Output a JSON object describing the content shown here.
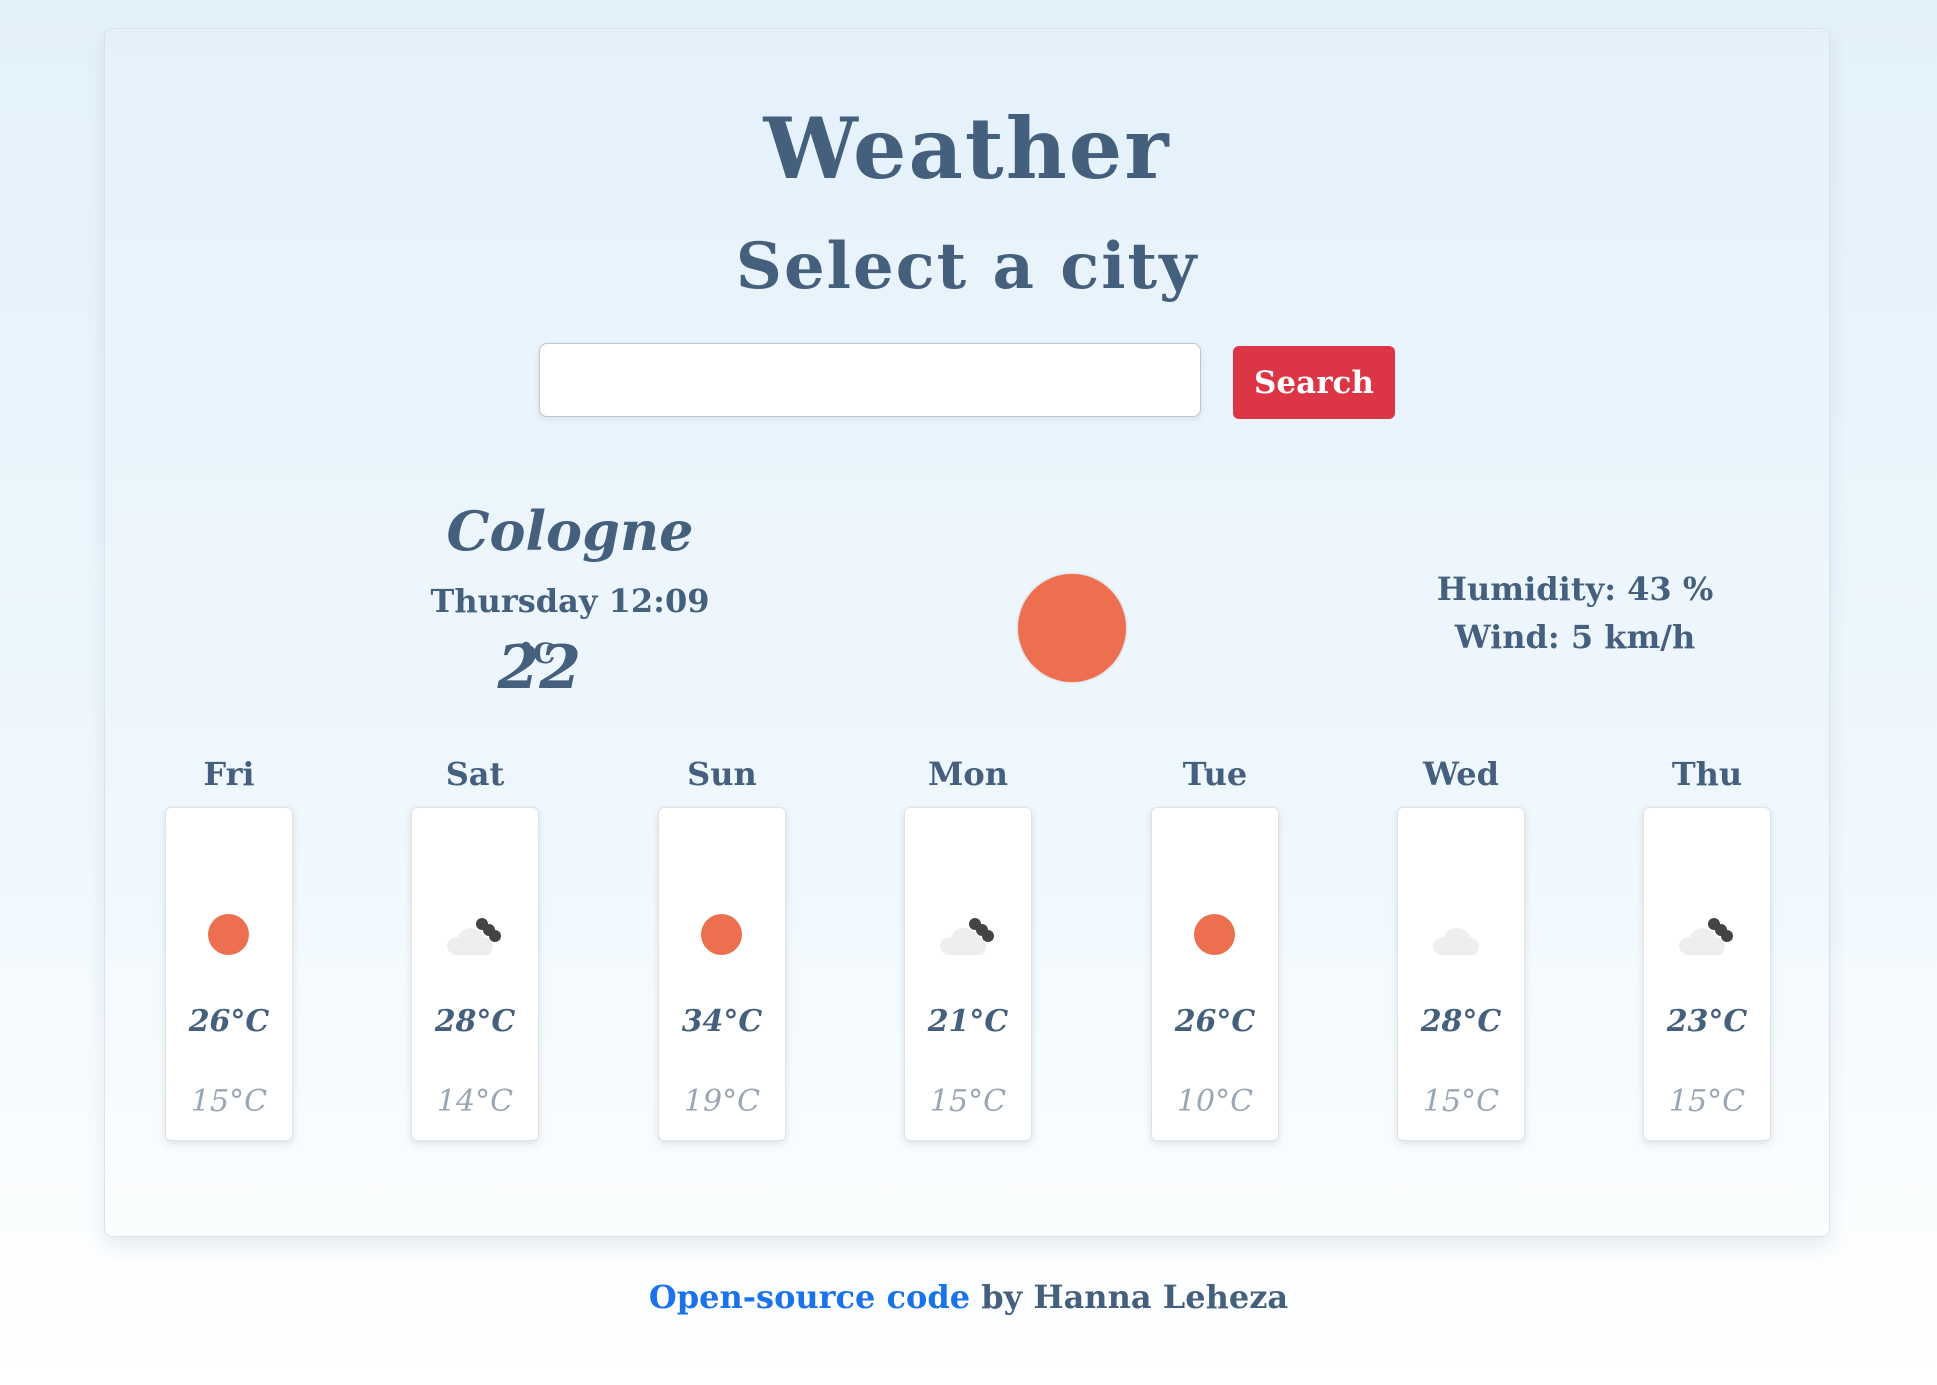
{
  "header": {
    "title": "Weather",
    "subtitle": "Select a city"
  },
  "search": {
    "value": "",
    "placeholder": "",
    "button_label": "Search"
  },
  "current": {
    "city": "Cologne",
    "datetime": "Thursday 12:09",
    "temperature": "22",
    "unit": "°C",
    "icon": "sun-icon",
    "humidity": "Humidity: 43 %",
    "wind": "Wind: 5 km/h"
  },
  "forecast": [
    {
      "day": "Fri",
      "icon": "sun-icon",
      "high": "26°C",
      "low": "15°C"
    },
    {
      "day": "Sat",
      "icon": "cloud-night-icon",
      "high": "28°C",
      "low": "14°C"
    },
    {
      "day": "Sun",
      "icon": "sun-icon",
      "high": "34°C",
      "low": "19°C"
    },
    {
      "day": "Mon",
      "icon": "cloud-night-icon",
      "high": "21°C",
      "low": "15°C"
    },
    {
      "day": "Tue",
      "icon": "sun-icon",
      "high": "26°C",
      "low": "10°C"
    },
    {
      "day": "Wed",
      "icon": "cloud-icon",
      "high": "28°C",
      "low": "15°C"
    },
    {
      "day": "Thu",
      "icon": "cloud-night-icon",
      "high": "23°C",
      "low": "15°C"
    }
  ],
  "footer": {
    "link_text": "Open-source code",
    "rest": " by Hanna Leheza"
  },
  "colors": {
    "accent": "#dc3545",
    "sun": "#ec704f",
    "text": "#45607d",
    "link": "#1a73e8",
    "muted": "#9aa6b3"
  }
}
